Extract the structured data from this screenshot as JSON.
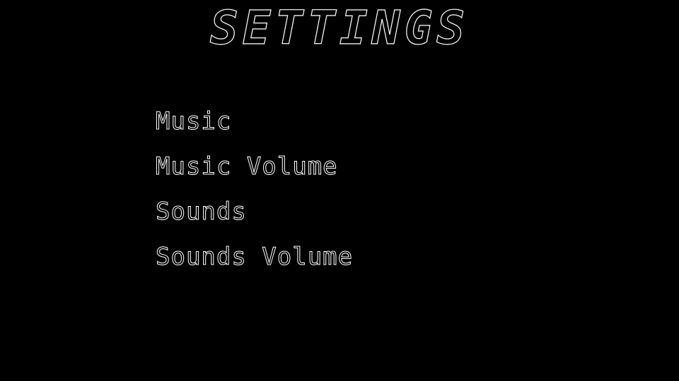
{
  "screen": {
    "title": "SETTINGS"
  },
  "menu": {
    "items": [
      {
        "label": "Music"
      },
      {
        "label": "Music Volume"
      },
      {
        "label": "Sounds"
      },
      {
        "label": "Sounds Volume"
      }
    ]
  },
  "colors": {
    "background": "#000000",
    "outline": "#ffffff"
  }
}
